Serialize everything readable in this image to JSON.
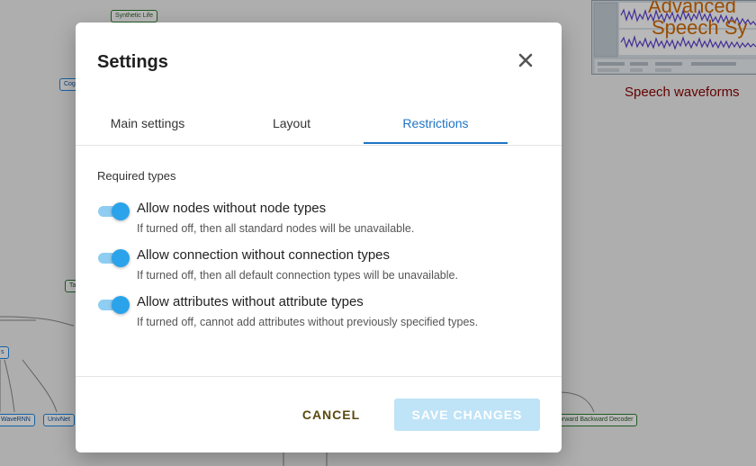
{
  "background": {
    "nodes": [
      {
        "label": "Synthetic Life"
      },
      {
        "label": "Cog"
      },
      {
        "label": "Ta"
      },
      {
        "label": "s"
      },
      {
        "label": "WaveRNN"
      },
      {
        "label": "UnivNet"
      },
      {
        "label": "orward Backward Decoder"
      }
    ],
    "thumbnail": {
      "title_line1": "Advanced",
      "title_line2": "Speech Sy",
      "caption": "Speech waveforms"
    }
  },
  "dialog": {
    "title": "Settings",
    "close_icon": "close-icon",
    "tabs": [
      {
        "label": "Main settings",
        "active": false
      },
      {
        "label": "Layout",
        "active": false
      },
      {
        "label": "Restrictions",
        "active": true
      }
    ],
    "section_label": "Required types",
    "options": [
      {
        "title": "Allow nodes without node types",
        "help": "If turned off, then all standard nodes will be unavailable.",
        "enabled": true
      },
      {
        "title": "Allow connection without connection types",
        "help": "If turned off, then all default connection types will be unavailable.",
        "enabled": true
      },
      {
        "title": "Allow attributes without attribute types",
        "help": "If turned off, cannot add attributes without previously specified types.",
        "enabled": true
      }
    ],
    "cancel_label": "CANCEL",
    "save_label": "SAVE CHANGES",
    "save_disabled": true
  },
  "colors": {
    "accent": "#1f74c4",
    "toggle_on": "#2ba3ea",
    "save_disabled_bg": "#bfe3f7"
  }
}
